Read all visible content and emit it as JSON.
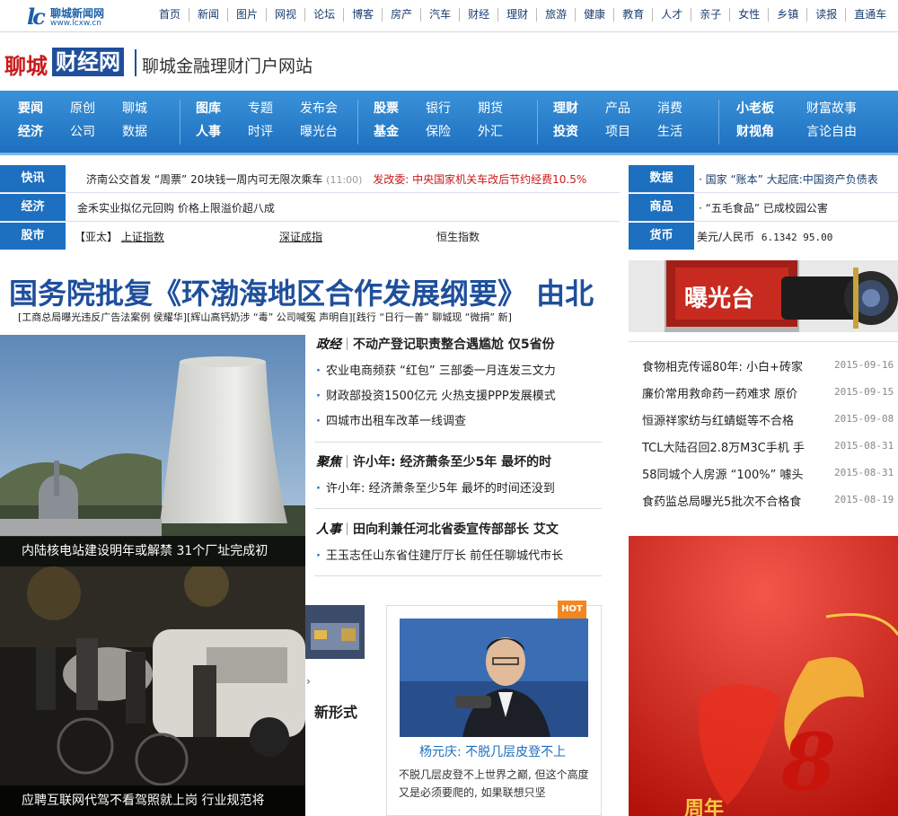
{
  "top_logo": {
    "mark": "lc",
    "name": "聊城新闻网",
    "url": "www.lcxw.cn"
  },
  "top_nav": [
    "首页",
    "新闻",
    "图片",
    "网视",
    "论坛",
    "博客",
    "房产",
    "汽车",
    "财经",
    "理财",
    "旅游",
    "健康",
    "教育",
    "人才",
    "亲子",
    "女性",
    "乡镇",
    "读报",
    "直通车"
  ],
  "brand": {
    "red": "聊城",
    "box": "财经网",
    "subtitle": "聊城金融理财门户网站"
  },
  "channels": [
    [
      [
        "要闻",
        "原创",
        "聊城"
      ],
      [
        "经济",
        "公司",
        "数据"
      ]
    ],
    [
      [
        "图库",
        "专题",
        "发布会"
      ],
      [
        "人事",
        "时评",
        "曝光台"
      ]
    ],
    [
      [
        "股票",
        "银行",
        "期货"
      ],
      [
        "基金",
        "保险",
        "外汇"
      ]
    ],
    [
      [
        "理财",
        "产品",
        "消费"
      ],
      [
        "投资",
        "项目",
        "生活"
      ]
    ],
    [
      [
        "小老板",
        "财富故事"
      ],
      [
        "财视角",
        "言论自由"
      ]
    ]
  ],
  "ticker": {
    "kuaixun": {
      "label": "快讯",
      "t1": "济南公交首发 “周票” 20块钱一周内可无限次乘车",
      "time": "(11:00)",
      "t2": "发改委: 中央国家机关车改后节约经费10.5%"
    },
    "jingji": {
      "label": "经济",
      "text": "金禾实业拟亿元回购 价格上限溢价超八成"
    },
    "gushi": {
      "label": "股市",
      "prefix": "【亚太】",
      "l1": "上证指数",
      "l2": "深证成指",
      "l3": "恒生指数"
    },
    "shuju": {
      "label": "数据",
      "text": "国家 “账本” 大起底:中国资产负债表"
    },
    "shangpin": {
      "label": "商品",
      "text": "“五毛食品” 已成校园公害"
    },
    "huobi": {
      "label": "货币",
      "pair": "美元/人民币",
      "value": "6.1342 95.00"
    }
  },
  "headline": "国务院批复《环渤海地区合作发展纲要》 由北",
  "subline": "[工商总局曝光违反广告法案例 侯耀华][辉山高钙奶涉 “毒” 公司喊冤 声明自][践行 “日行一善” 聊城现 “微捐” 新]",
  "photo1_caption": "内陆核电站建设明年或解禁 31个厂址完成初",
  "photo2_caption": "应聘互联网代驾不看驾照就上岗 行业规范将",
  "sections": [
    {
      "tag": "政经",
      "title": "不动产登记职责整合遇尴尬 仅5省份",
      "items": [
        "农业电商频获 “红包” 三部委一月连发三文力",
        "财政部投资1500亿元 火热支援PPP发展模式",
        "四城市出租车改革一线调查"
      ]
    },
    {
      "tag": "聚焦",
      "title": "许小年: 经济萧条至少5年 最坏的时",
      "items": [
        "许小年: 经济萧条至少5年 最坏的时间还没到"
      ]
    },
    {
      "tag": "人事",
      "title": "田向利兼任河北省委宣传部部长 艾文",
      "items": [
        "王玉志任山东省住建厅厅长 前任任聊城代市长"
      ]
    }
  ],
  "xinxing": "新形式",
  "feature": {
    "badge": "HOT",
    "name": "杨元庆: 不脱几层皮登不上",
    "desc": "不脱几层皮登不上世界之巅, 但这个高度又是必须要爬的, 如果联想只坚"
  },
  "baoguangtai": {
    "label": "曝光台"
  },
  "right_list": [
    {
      "title": "食物相克传谣80年: 小白+砖家",
      "date": "2015-09-16"
    },
    {
      "title": "廉价常用救命药一药难求 原价",
      "date": "2015-09-15"
    },
    {
      "title": "恒源祥家纺与红蜻蜓等不合格",
      "date": "2015-09-08"
    },
    {
      "title": "TCL大陆召回2.8万M3C手机 手",
      "date": "2015-08-31"
    },
    {
      "title": "58同城个人房源 “100%” 噱头",
      "date": "2015-08-31"
    },
    {
      "title": "食药监总局曝光5批次不合格食",
      "date": "2015-08-19"
    }
  ],
  "promo": {
    "big": "8",
    "small": "周年"
  },
  "colors": {
    "brand_blue": "#1d6fbf",
    "brand_red": "#c81a1a",
    "headline_blue": "#1f4f9c"
  }
}
